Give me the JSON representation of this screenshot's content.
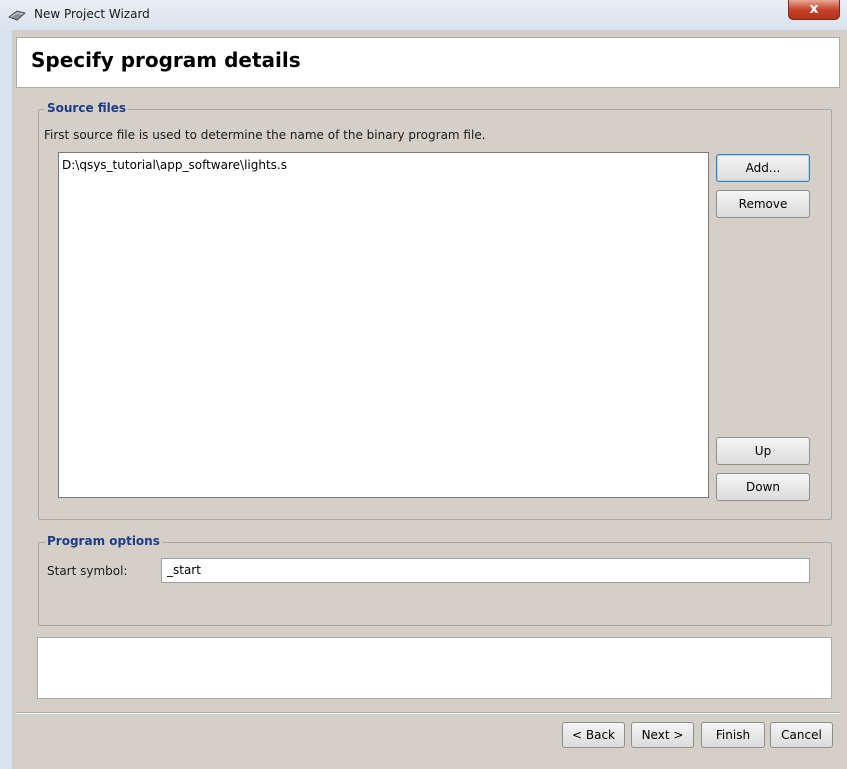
{
  "window": {
    "title": "New Project Wizard",
    "close_label": "x"
  },
  "header": {
    "title": "Specify program details"
  },
  "source_files": {
    "legend": "Source files",
    "hint": "First source file is used to determine the name of the binary program file.",
    "files": [
      "D:\\qsys_tutorial\\app_software\\lights.s"
    ],
    "add_label": "Add...",
    "remove_label": "Remove",
    "up_label": "Up",
    "down_label": "Down"
  },
  "program_options": {
    "legend": "Program options",
    "start_symbol_label": "Start symbol:",
    "start_symbol_value": "_start"
  },
  "footer": {
    "back_label": "< Back",
    "next_label": "Next >",
    "finish_label": "Finish",
    "cancel_label": "Cancel"
  },
  "icons": {
    "title_icon": "wizard-icon",
    "close_icon": "close-icon"
  },
  "colors": {
    "legend_blue": "#1f3c88",
    "close_red": "#c7432a"
  }
}
